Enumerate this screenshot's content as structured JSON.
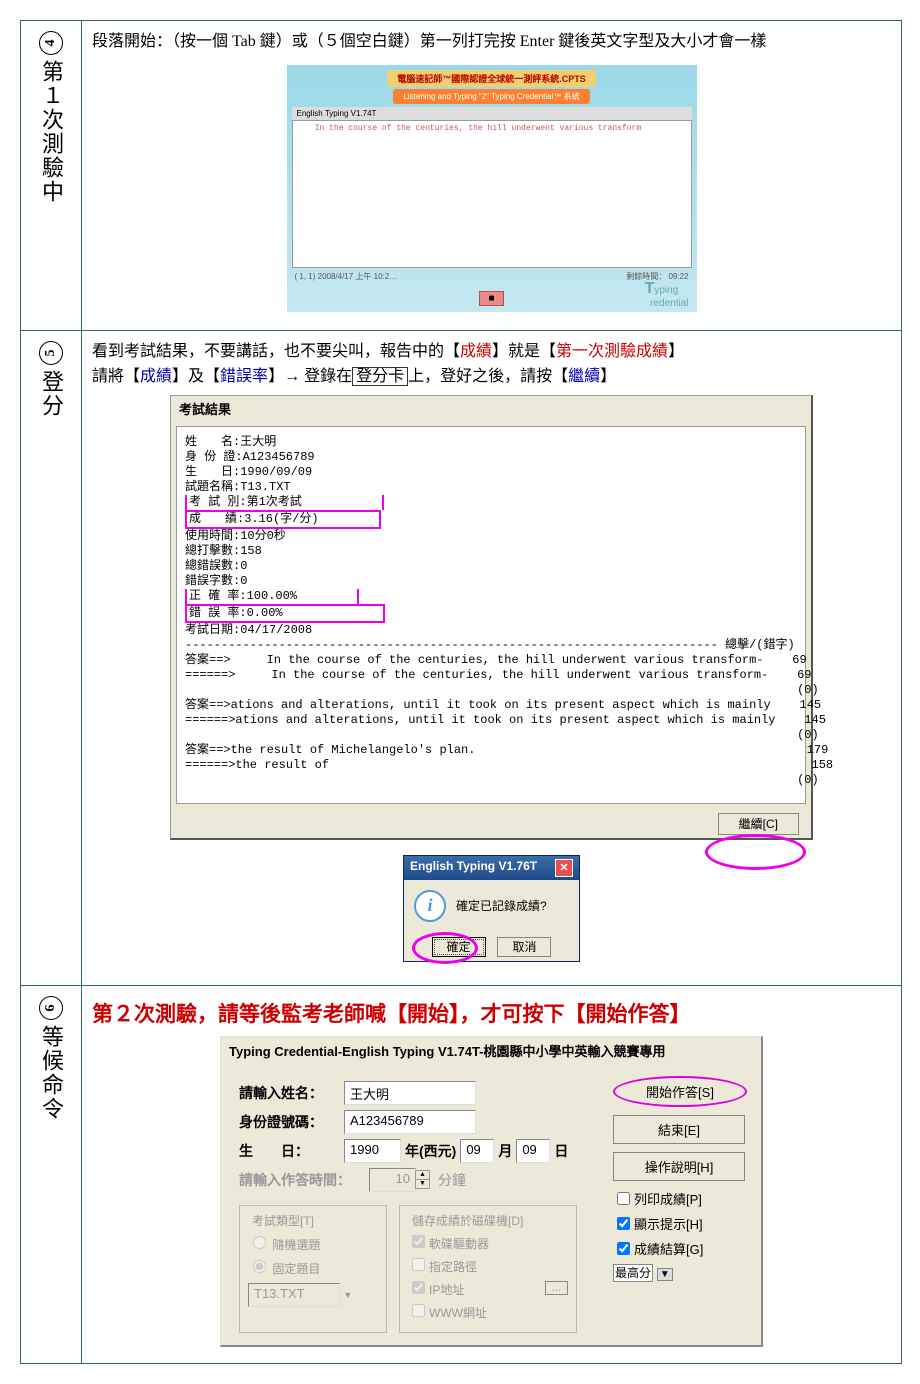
{
  "step4": {
    "num": "4",
    "side": "第１次測驗中",
    "para": "段落開始：（按一個 Tab 鍵）或（５個空白鍵）第一列打完按 Enter 鍵後英文字型及大小才會一樣",
    "win_h1": "電腦速記師™國際認證全球統一測評系統.CPTS",
    "win_h2": "Listening and Typing \"2\" Typing Credential™ 系統",
    "win_bar": "English Typing V1.74T",
    "win_text": "In the course of the centuries, the hill underwent various transform",
    "win_stat_l": "( 1, 1)    2008/4/17   上午 10:2…",
    "win_stat_r": "剩餘時間： 09:22",
    "logo1": "T",
    "logo2": "yping",
    "logo3": "redential"
  },
  "step5": {
    "num": "5",
    "side": "登分",
    "p1a": "看到考試結果，不要講話，也不要尖叫，報告中的【",
    "p1b": "成績",
    "p1c": "】就是【",
    "p1d": "第一次測驗成績",
    "p1e": "】",
    "p2a": "請將【",
    "p2b": "成績",
    "p2c": "】及【",
    "p2d": "錯誤率",
    "p2e": "】→  登錄在",
    "p2f": "登分卡",
    "p2g": "上，登好之後，請按【",
    "p2h": "繼續",
    "p2i": "】",
    "res_title": "考試結果",
    "lines": {
      "l1": "姓　　名:王大明",
      "l2": "身 份 證:A123456789",
      "l3": "生　　日:1990/09/09",
      "l4": "試題名稱:T13.TXT",
      "l5": "考 試 別:第1次考試",
      "l6": "成　　績:3.16(字/分)",
      "l7": "使用時間:10分0秒",
      "l8": "總打擊數:158",
      "l9": "總錯誤數:0",
      "l10": "錯誤字數:0",
      "l11": "正 確 率:100.00%",
      "l12": "錯 誤 率:0.00%",
      "l13": "考試日期:04/17/2008"
    },
    "hdr": "-------------------------------------------------------------------------- 總擊/(錯字)",
    "a1": "答案==>     In the course of the centuries, the hill underwent various transform-    69",
    "a2": "======>     In the course of the centuries, the hill underwent various transform-    69",
    "a2b": "                                                                                     (0)",
    "a3": "答案==>ations and alterations, until it took on its present aspect which is mainly    145",
    "a4": "======>ations and alterations, until it took on its present aspect which is mainly    145",
    "a4b": "                                                                                     (0)",
    "a5": "答案==>the result of Michelangelo's plan.                                              179",
    "a6": "======>the result of                                                                   158",
    "a6b": "                                                                                     (0)",
    "btn_continue": "繼續[C]",
    "dlg_title": "English Typing V1.76T",
    "dlg_msg": "確定已記錄成績?",
    "dlg_ok": "確定",
    "dlg_cancel": "取消"
  },
  "step6": {
    "num": "6",
    "side": "等候命令",
    "h": "第２次測驗，請等後監考老師喊【開始】，才可按下【開始作答】",
    "title": "Typing Credential-English Typing V1.74T-桃園縣中小學中英輸入競賽專用",
    "lbl_name": "請輸入姓名：",
    "val_name": "王大明",
    "lbl_id": "身份證號碼：",
    "val_id": "A123456789",
    "lbl_bday": "生　　日：",
    "y": "1990",
    "ytxt": "年(西元)",
    "m": "09",
    "mtxt": "月",
    "d": "09",
    "dtxt": "日",
    "lbl_time": "請輸入作答時間：",
    "val_time": "10",
    "min": "分鐘",
    "btn_start": "開始作答[S]",
    "btn_end": "結束[E]",
    "btn_help": "操作說明[H]",
    "fs1_title": "考試類型[T]",
    "fs1_r1": "隨機選題",
    "fs1_r2": "固定題目",
    "fs1_file": "T13.TXT",
    "fs2_title": "儲存成績於磁碟機[D]",
    "fs2_1": "軟碟驅動器",
    "fs2_2": "指定路徑",
    "fs2_3": "IP地址",
    "fs2_4": "WWW網址",
    "cb_print": "列印成績[P]",
    "cb_hint": "顯示提示[H]",
    "cb_calc": "成績結算[G]",
    "sel": "最高分"
  }
}
